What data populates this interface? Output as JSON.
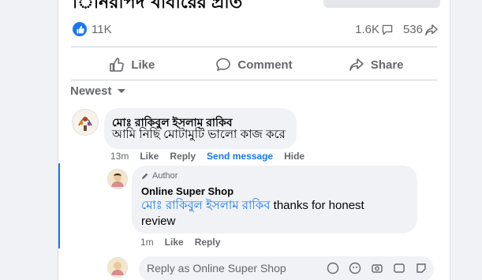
{
  "post_top": {
    "partial_title": "িনিরাপদ খাবারের প্রতি"
  },
  "reactions": {
    "like_count": "11K",
    "comment_count": "1.6K",
    "share_count": "536"
  },
  "actions": {
    "like_label": "Like",
    "comment_label": "Comment",
    "share_label": "Share"
  },
  "sort": {
    "label": "Newest"
  },
  "comment": {
    "author": "মোঃ রাকিবুল ইসলাম রাকিব",
    "text": "আমি নিছি মোটামুটি ভালো কাজ করে",
    "time": "13m",
    "like_label": "Like",
    "reply_label": "Reply",
    "send_message_label": "Send message",
    "hide_label": "Hide"
  },
  "reply": {
    "badge": "Author",
    "author": "Online Super Shop",
    "mention": "মোঃ রাকিবুল ইসলাম রাকিব",
    "text": " thanks for honest review",
    "time": "1m",
    "like_label": "Like",
    "reply_label": "Reply"
  },
  "reply_input": {
    "placeholder": "Reply as Online Super Shop"
  },
  "colors": {
    "accent": "#1877f2",
    "muted": "#65676b",
    "bubble": "#f0f2f5"
  }
}
